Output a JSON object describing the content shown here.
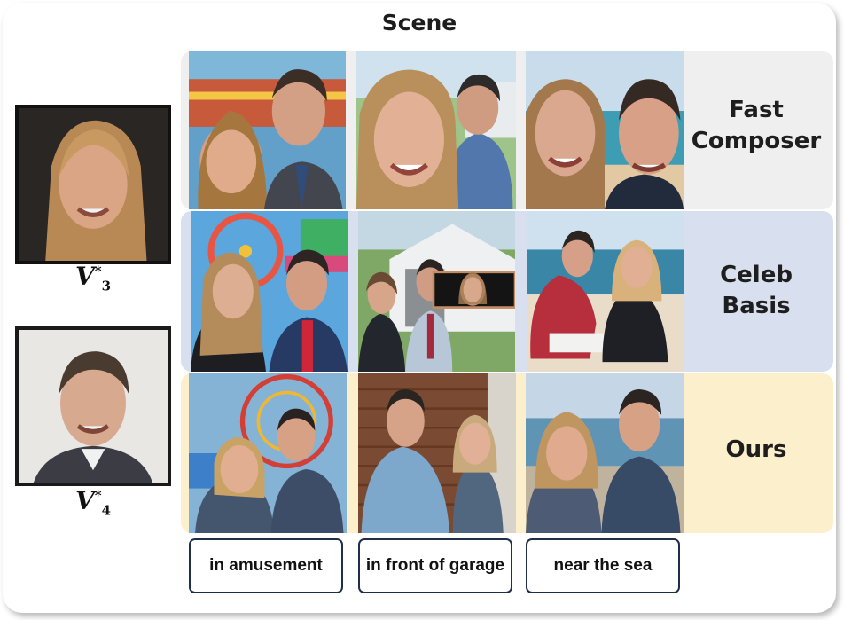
{
  "header": {
    "title": "Scene"
  },
  "rows": [
    {
      "label": "Fast Composer"
    },
    {
      "label": "Celeb Basis"
    },
    {
      "label": "Ours"
    }
  ],
  "references": [
    {
      "sup": "*",
      "base": "V",
      "sub": "3"
    },
    {
      "sup": "*",
      "base": "V",
      "sub": "4"
    }
  ],
  "prompts": [
    "in amusement",
    "in front of garage",
    "near the sea"
  ]
}
